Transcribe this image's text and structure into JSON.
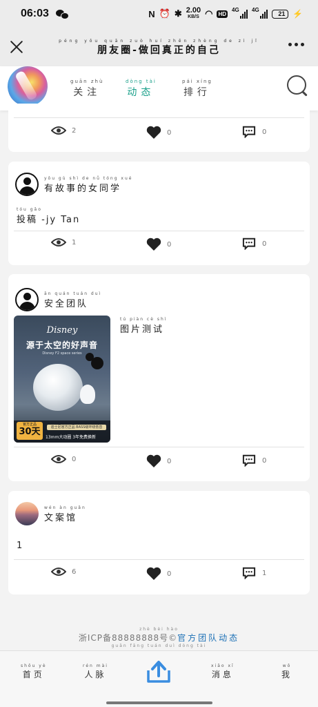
{
  "status_bar": {
    "time": "06:03",
    "net_speed_value": "2.00",
    "net_speed_unit": "KB/S",
    "hd_label": "HD",
    "signal1_label": "4G",
    "signal2_label": "4G",
    "battery_level": "21",
    "battery_fraction": 0.21
  },
  "title_bar": {
    "title": "朋友圈-做回真正的自己",
    "title_pinyin": "péng yǒu quān zuò huí zhēn zhèng de zì jǐ"
  },
  "nav": {
    "tabs": [
      {
        "label": "关注",
        "pinyin": "guān zhù",
        "active": false
      },
      {
        "label": "动态",
        "pinyin": "dòng tài",
        "active": true
      },
      {
        "label": "排行",
        "pinyin": "pái xíng",
        "active": false
      }
    ]
  },
  "posts": [
    {
      "views": "2",
      "likes": "0",
      "comments": "0"
    },
    {
      "author": "有故事的女同学",
      "author_pinyin": "yǒu gù shì de nǚ tóng xué",
      "text": "投稿 -jy Tan",
      "text_pinyin": "tóu gǎo",
      "views": "1",
      "likes": "0",
      "comments": "0"
    },
    {
      "author": "安全团队",
      "author_pinyin": "ān quán tuán duì",
      "text": "图片测试",
      "text_pinyin": "tú piàn cè shì",
      "image": {
        "brand": "Disney",
        "headline": "源于太空的好声音",
        "subline": "Disney F2 space series",
        "badge_top": "官方正品",
        "badge_big": "30天",
        "bar_text": "迪士尼官方正品 BASS级环绕低音",
        "footer_text": "13mm大动圈  3年免费换新"
      },
      "views": "0",
      "likes": "0",
      "comments": "0"
    },
    {
      "author": "文案馆",
      "author_pinyin": "wén àn guǎn",
      "text": "1",
      "views": "6",
      "likes": "0",
      "comments": "1"
    }
  ],
  "footer": {
    "icp_text": "浙ICP备88888888号©",
    "icp_pinyin": "zhè bèi hào",
    "link_text": "官方团队动态",
    "link_pinyin": "guān fāng tuán duì dòng tài"
  },
  "tab_bar": {
    "tabs": [
      {
        "label": "首页",
        "pinyin": "shǒu yè"
      },
      {
        "label": "人脉",
        "pinyin": "rén mài"
      },
      {
        "label": "消息",
        "pinyin": "xiāo xī"
      },
      {
        "label": "我",
        "pinyin": "wǒ"
      }
    ]
  },
  "colors": {
    "accent": "#1aa08a",
    "link": "#1a6fb5",
    "upload_icon": "#3a8de0"
  },
  "icons": {
    "view": "eye-icon",
    "like": "heart-icon",
    "comment": "comment-icon",
    "search": "search-icon",
    "upload": "upload-icon"
  }
}
